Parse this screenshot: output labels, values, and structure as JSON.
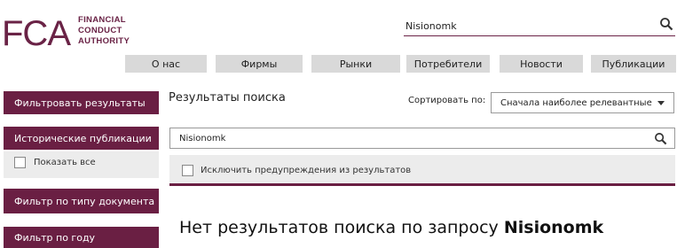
{
  "logo": {
    "mark": "FCA",
    "line1": "FINANCIAL",
    "line2": "CONDUCT",
    "line3": "AUTHORITY"
  },
  "header_search": {
    "value": "Nisionomk",
    "icon": "search-icon"
  },
  "nav": {
    "items": [
      "О нас",
      "Фирмы",
      "Рынки",
      "Потребители",
      "Новости",
      "Публикации"
    ]
  },
  "sidebar": {
    "filter_results": "Фильтровать результаты",
    "historical": "Исторические публикации",
    "show_all": "Показать все",
    "filter_doc_type": "Фильтр по типу документа",
    "filter_year": "Фильтр по году"
  },
  "main": {
    "title": "Результаты поиска",
    "sort_label": "Сортировать по:",
    "sort_value": "Сначала наиболее релевантные",
    "search_value": "Nisionomk",
    "exclude_warnings": "Исключить предупреждения из результатов",
    "no_results_prefix": "Нет результатов поиска по запросу",
    "no_results_query": "Nisionomk"
  },
  "colors": {
    "brand": "#6a1f43",
    "nav_bg": "#d9d9d9",
    "panel_bg": "#ececec"
  }
}
